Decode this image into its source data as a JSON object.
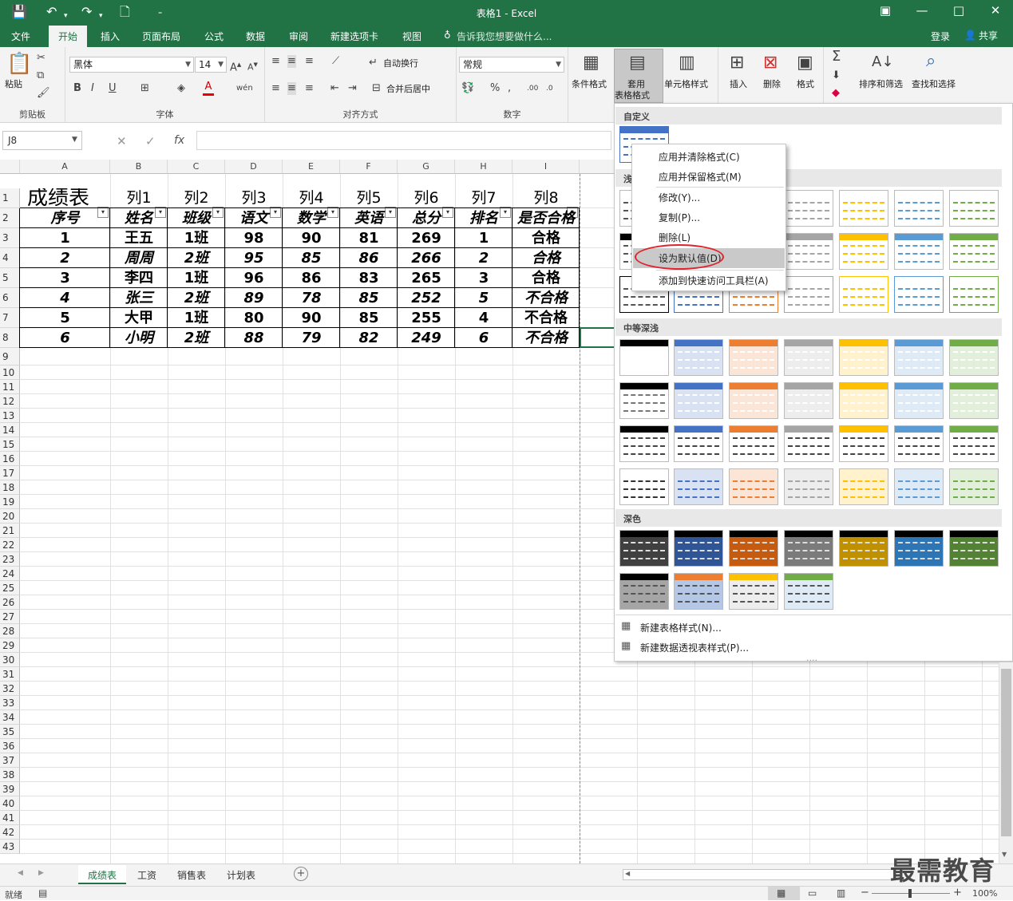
{
  "window": {
    "title": "表格1 - Excel"
  },
  "ribbon_tabs": [
    {
      "label": "文件"
    },
    {
      "label": "开始"
    },
    {
      "label": "插入"
    },
    {
      "label": "页面布局"
    },
    {
      "label": "公式"
    },
    {
      "label": "数据"
    },
    {
      "label": "审阅"
    },
    {
      "label": "新建选项卡"
    },
    {
      "label": "视图"
    }
  ],
  "tell_me": "告诉我您想要做什么...",
  "login": "登录",
  "share": "共享",
  "groups": {
    "clipboard": "剪贴板",
    "font": "字体",
    "align": "对齐方式",
    "number": "数字"
  },
  "buttons": {
    "paste": "粘贴",
    "wrap": "自动换行",
    "merge": "合并后居中",
    "cond_format": "条件格式",
    "table_format_1": "套用",
    "table_format_2": "表格格式",
    "cell_style": "单元格样式",
    "insert": "插入",
    "delete": "删除",
    "format": "格式",
    "sort_filter": "排序和筛选",
    "find_select": "查找和选择"
  },
  "font": {
    "name": "黑体",
    "size": "14"
  },
  "number_format": "常规",
  "name_box": "J8",
  "columns": [
    "A",
    "B",
    "C",
    "D",
    "E",
    "F",
    "G",
    "H",
    "I"
  ],
  "rows": [
    "1",
    "2",
    "3",
    "4",
    "5",
    "6",
    "7",
    "8",
    "9",
    "10",
    "11",
    "12",
    "13",
    "14",
    "15",
    "16",
    "17",
    "18",
    "19",
    "20",
    "21",
    "22",
    "23",
    "24",
    "25",
    "26",
    "27",
    "28",
    "29",
    "30",
    "31",
    "32",
    "33",
    "34",
    "35",
    "36",
    "37",
    "38",
    "39",
    "40",
    "41",
    "42",
    "43"
  ],
  "table": {
    "title": "成绩表",
    "filter_headers": [
      "列1",
      "列2",
      "列3",
      "列4",
      "列5",
      "列6",
      "列7",
      "列8"
    ],
    "headers": [
      "序号",
      "姓名",
      "班级",
      "语文",
      "数学",
      "英语",
      "总分",
      "排名",
      "是否合格"
    ],
    "data": [
      [
        "1",
        "王五",
        "1班",
        "98",
        "90",
        "81",
        "269",
        "1",
        "合格"
      ],
      [
        "2",
        "周周",
        "2班",
        "95",
        "85",
        "86",
        "266",
        "2",
        "合格"
      ],
      [
        "3",
        "李四",
        "1班",
        "96",
        "86",
        "83",
        "265",
        "3",
        "合格"
      ],
      [
        "4",
        "张三",
        "2班",
        "89",
        "78",
        "85",
        "252",
        "5",
        "不合格"
      ],
      [
        "5",
        "大甲",
        "1班",
        "80",
        "90",
        "85",
        "255",
        "4",
        "不合格"
      ],
      [
        "6",
        "小明",
        "2班",
        "88",
        "79",
        "82",
        "249",
        "6",
        "不合格"
      ]
    ]
  },
  "gallery": {
    "sections": [
      "自定义",
      "浅",
      "中等深浅",
      "深色"
    ],
    "footer": [
      "新建表格样式(N)...",
      "新建数据透视表样式(P)..."
    ]
  },
  "context_menu": [
    "应用并清除格式(C)",
    "应用并保留格式(M)",
    "修改(Y)...",
    "复制(P)...",
    "删除(L)",
    "设为默认值(D)",
    "添加到快速访问工具栏(A)"
  ],
  "sheet_tabs": [
    "成绩表",
    "工资",
    "销售表",
    "计划表"
  ],
  "status": {
    "ready": "就绪",
    "zoom": "100%"
  },
  "watermark": "最需教育",
  "colors": {
    "excel_green": "#217346",
    "highlight_red": "#e0242f"
  }
}
